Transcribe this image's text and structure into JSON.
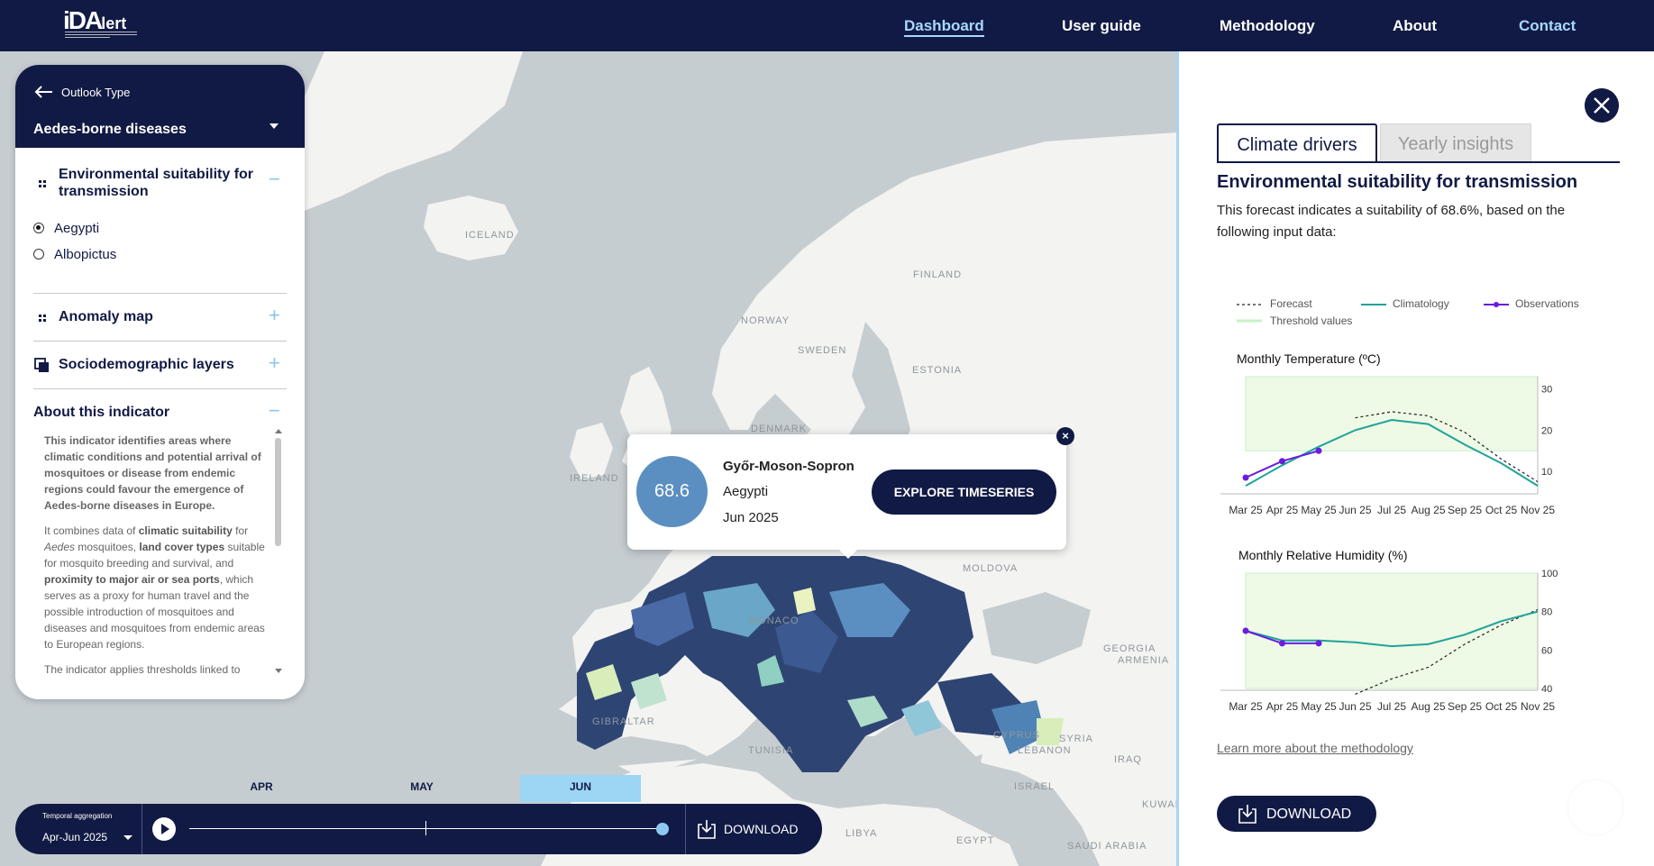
{
  "header": {
    "logo": "iDAlert",
    "nav": [
      "Dashboard",
      "User guide",
      "Methodology",
      "About",
      "Contact"
    ],
    "active": "Dashboard"
  },
  "left_panel": {
    "outlook_label": "Outlook Type",
    "disease": "Aedes-borne diseases",
    "sections": {
      "env": "Environmental suitability for transmission",
      "anomaly": "Anomaly map",
      "socio": "Sociodemographic layers",
      "about": "About this indicator"
    },
    "species": [
      {
        "label": "Aegypti",
        "selected": true
      },
      {
        "label": "Albopictus",
        "selected": false
      }
    ],
    "about_paragraphs": {
      "p1": "This indicator identifies areas where climatic conditions and potential arrival of mosquitoes or disease from endemic regions could favour the emergence of Aedes-borne diseases in Europe.",
      "p2_a": "It combines data of ",
      "p2_b": "climatic suitability",
      "p2_c": " for ",
      "p2_d": "Aedes",
      "p2_e": " mosquitoes, ",
      "p2_f": "land cover types",
      "p2_g": " suitable for mosquito breeding and survival, and ",
      "p2_h": "proximity to major air or sea ports",
      "p2_i": ", which serves as a proxy for human travel and the possible introduction of mosquitoes and diseases and mosquitoes from endemic areas to European regions.",
      "p3": "The indicator applies thresholds linked to"
    }
  },
  "map_labels": [
    "ICELAND",
    "FINLAND",
    "NORWAY",
    "SWEDEN",
    "ESTONIA",
    "DENMARK",
    "IRELAND",
    "MOLDOVA",
    "MONACO",
    "GEORGIA",
    "ARMENIA",
    "GIBRALTAR",
    "TUNISIA",
    "CYPRUS",
    "SYRIA",
    "LEBANON",
    "IRAQ",
    "ISRAEL",
    "KUWAIT",
    "LIBYA",
    "EGYPT",
    "SAUDI ARABIA"
  ],
  "popup": {
    "value": "68.6",
    "region": "Győr-Moson-Sopron",
    "species": "Aegypti",
    "month": "Jun 2025",
    "button": "EXPLORE TIMESERIES",
    "color": "#5b8fc1"
  },
  "timeline": {
    "months": [
      "APR",
      "MAY",
      "JUN"
    ],
    "selected_month": "JUN",
    "aggregation_label": "Temporal aggregation",
    "aggregation_value": "Apr-Jun 2025",
    "progress": 1.0,
    "download": "DOWNLOAD"
  },
  "right_panel": {
    "tabs": [
      "Climate drivers",
      "Yearly insights"
    ],
    "active_tab": "Climate drivers",
    "title": "Environmental suitability for transmission",
    "description": "This forecast indicates a suitability of 68.6%, based on the following input data:",
    "legend": [
      "Forecast",
      "Climatology",
      "Observations",
      "Threshold values"
    ],
    "link": "Learn more about the methodology",
    "download": "DOWNLOAD"
  },
  "chart_data": [
    {
      "type": "line",
      "title": "Monthly Temperature (ºC)",
      "categories": [
        "Mar 25",
        "Apr 25",
        "May 25",
        "Jun 25",
        "Jul 25",
        "Aug 25",
        "Sep 25",
        "Oct 25",
        "Nov 25"
      ],
      "yticks": [
        10,
        20,
        30
      ],
      "ylim": [
        5,
        33
      ],
      "threshold_band": [
        15,
        33
      ],
      "series": [
        {
          "name": "Forecast",
          "style": "dashed",
          "color": "#222222",
          "values": [
            null,
            null,
            null,
            23,
            24.5,
            23.5,
            19.5,
            13,
            7.5
          ]
        },
        {
          "name": "Climatology",
          "style": "solid",
          "color": "#1fa39a",
          "values": [
            6.5,
            11.5,
            16,
            20,
            22.5,
            21.5,
            16.5,
            12,
            6.5
          ]
        },
        {
          "name": "Observations",
          "style": "markers",
          "color": "#6a1de0",
          "values": [
            8.5,
            12.5,
            15,
            null,
            null,
            null,
            null,
            null,
            null
          ]
        }
      ]
    },
    {
      "type": "line",
      "title": "Monthly Relative Humidity (%)",
      "categories": [
        "Mar 25",
        "Apr 25",
        "May 25",
        "Jun 25",
        "Jul 25",
        "Aug 25",
        "Sep 25",
        "Oct 25",
        "Nov 25"
      ],
      "yticks": [
        40,
        60,
        80,
        100
      ],
      "ylim": [
        40,
        100
      ],
      "threshold_band": [
        40,
        100
      ],
      "series": [
        {
          "name": "Forecast",
          "style": "dashed",
          "color": "#222222",
          "values": [
            null,
            null,
            null,
            37,
            45,
            51,
            63,
            73,
            81
          ]
        },
        {
          "name": "Climatology",
          "style": "solid",
          "color": "#1fa39a",
          "values": [
            70,
            65,
            65,
            64,
            62,
            63,
            68,
            75,
            80
          ]
        },
        {
          "name": "Observations",
          "style": "markers",
          "color": "#6a1de0",
          "values": [
            70,
            63.5,
            63.5,
            null,
            null,
            null,
            null,
            null,
            null
          ]
        }
      ]
    }
  ]
}
